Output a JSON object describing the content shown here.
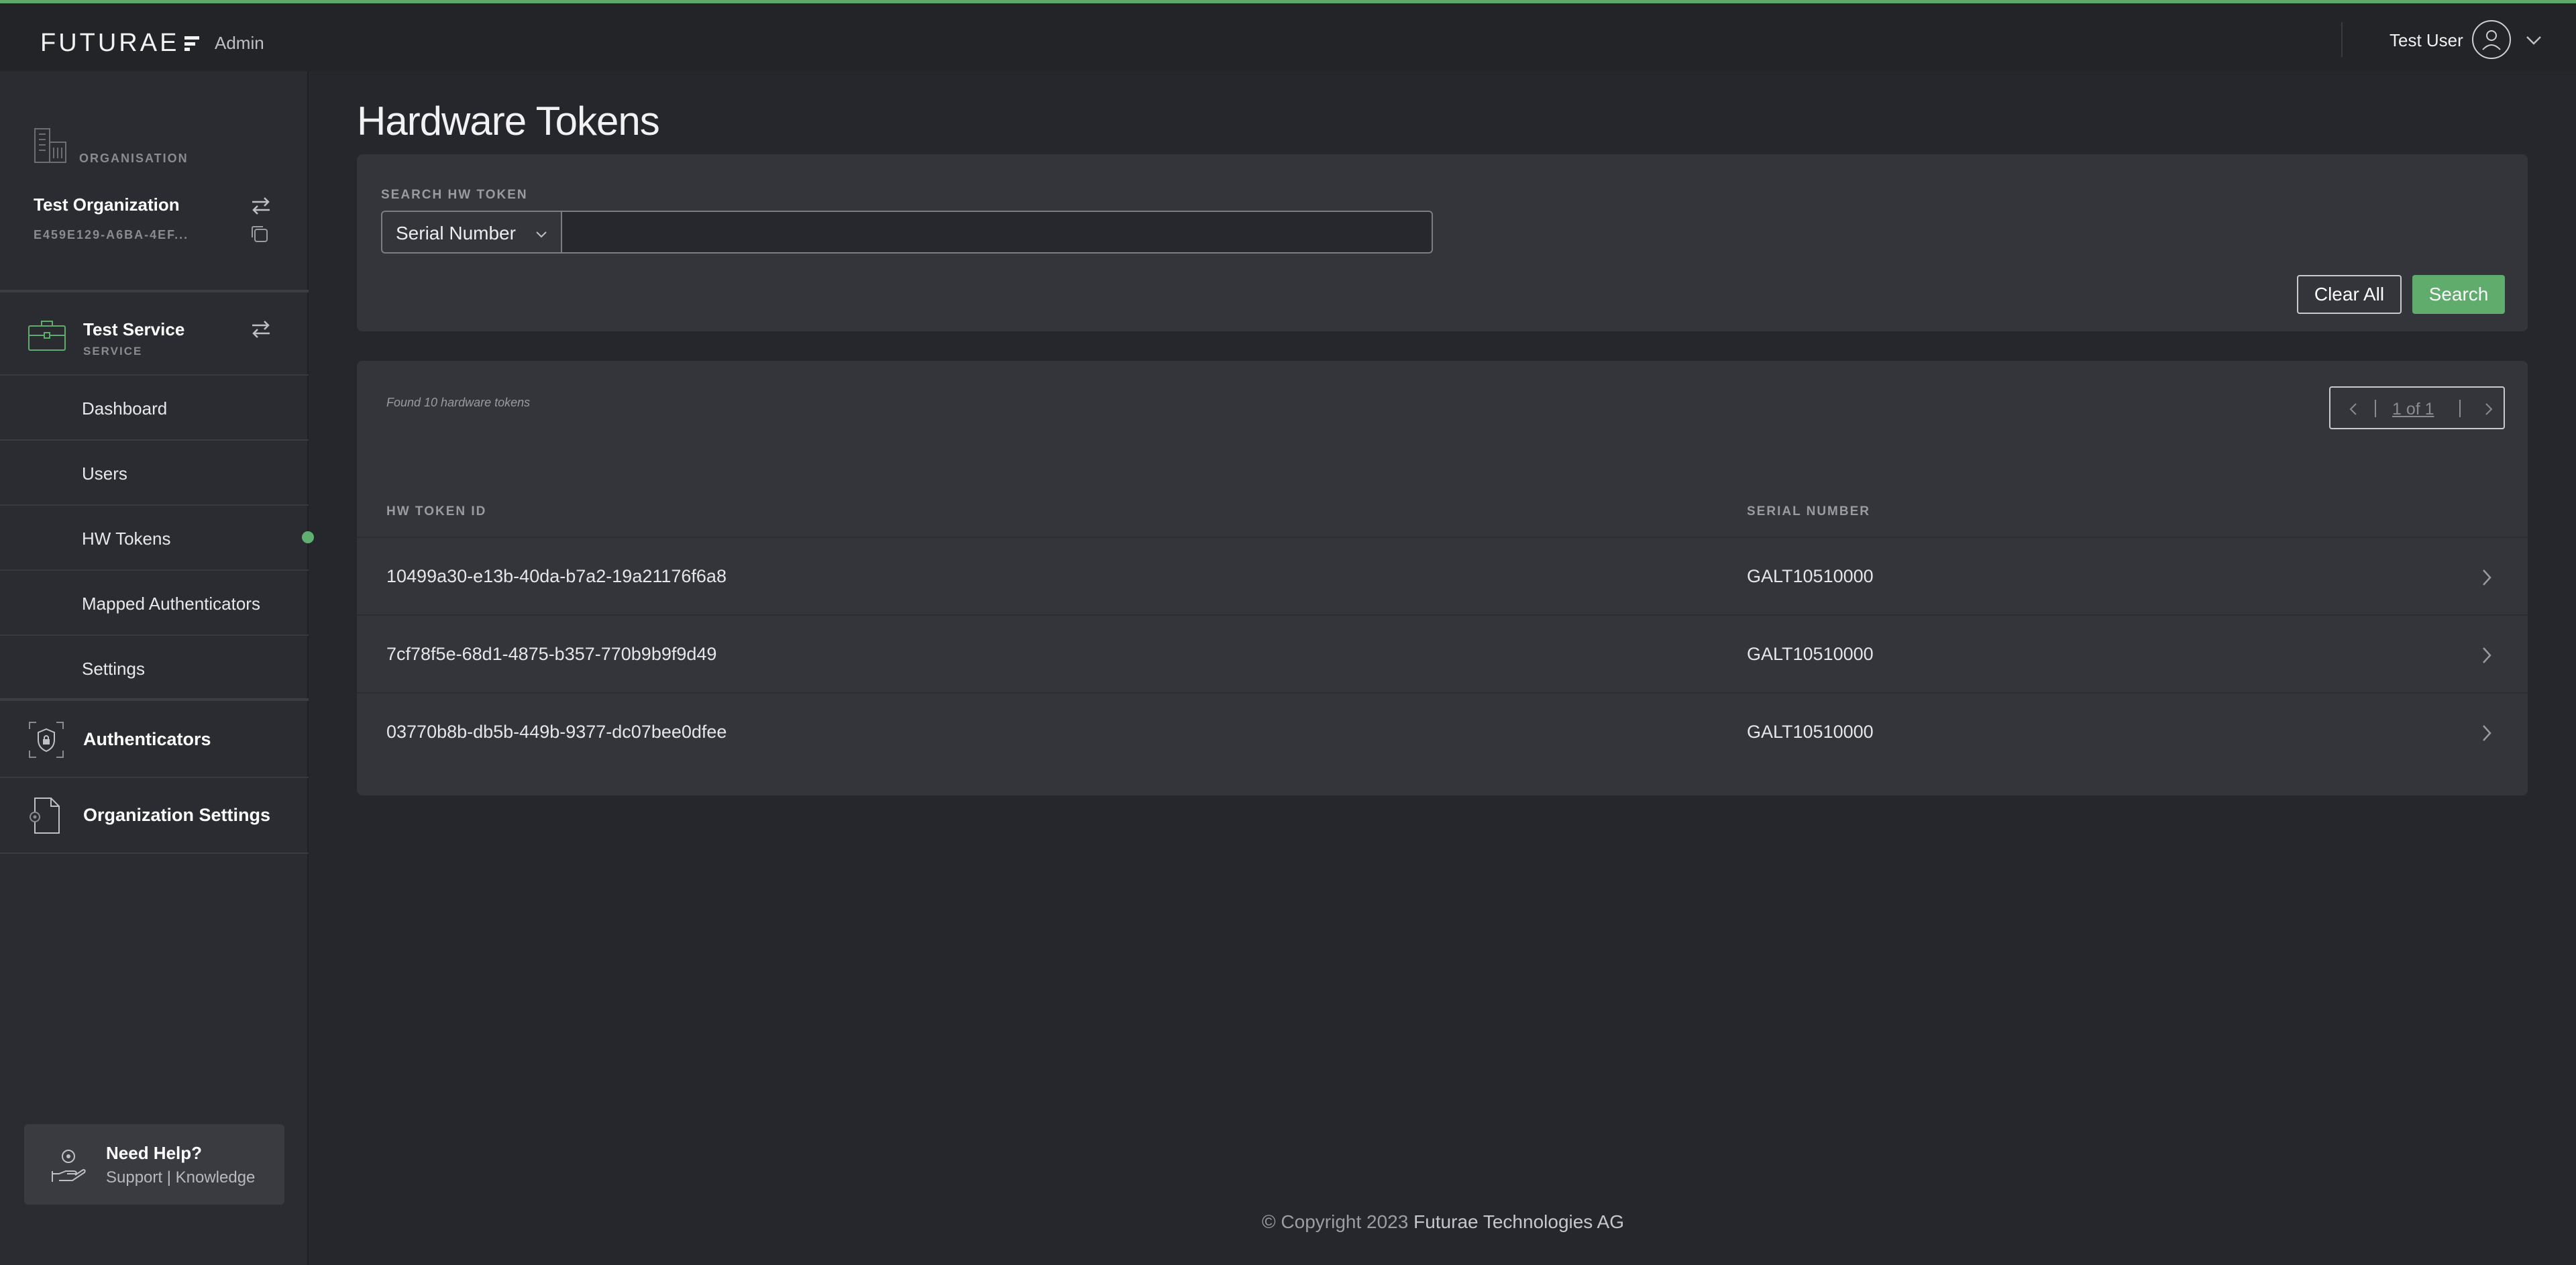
{
  "header": {
    "logo_text": "FUTURAE",
    "section": "Admin",
    "user_name": "Test User"
  },
  "sidebar": {
    "org_caption": "ORGANISATION",
    "org_name": "Test Organization",
    "org_id": "E459E129-A6BA-4EF...",
    "service_name": "Test Service",
    "service_caption": "SERVICE",
    "nav": [
      {
        "label": "Dashboard"
      },
      {
        "label": "Users"
      },
      {
        "label": "HW Tokens"
      },
      {
        "label": "Mapped Authenticators"
      },
      {
        "label": "Settings"
      }
    ],
    "sections": [
      {
        "label": "Authenticators"
      },
      {
        "label": "Organization Settings"
      }
    ],
    "help": {
      "title": "Need Help?",
      "links": "Support | Knowledge"
    }
  },
  "page": {
    "title": "Hardware Tokens"
  },
  "search": {
    "caption": "SEARCH HW TOKEN",
    "field_selected": "Serial Number",
    "value": "",
    "clear_label": "Clear All",
    "search_label": "Search"
  },
  "results": {
    "count_text": "Found 10 hardware tokens",
    "pager_text": "1 of 1",
    "columns": [
      "HW TOKEN ID",
      "SERIAL NUMBER"
    ],
    "rows": [
      {
        "id": "10499a30-e13b-40da-b7a2-19a21176f6a8",
        "serial": "GALT10510000"
      },
      {
        "id": "7cf78f5e-68d1-4875-b357-770b9b9f9d49",
        "serial": "GALT10510000"
      },
      {
        "id": "03770b8b-db5b-449b-9377-dc07bee0dfee",
        "serial": "GALT10510000"
      }
    ]
  },
  "footer": {
    "copyright": "© Copyright 2023",
    "company": "Futurae Technologies AG"
  },
  "colors": {
    "accent": "#5fac6c",
    "background": "#26272c",
    "sidebar": "#2b2c31",
    "card": "#34353b"
  }
}
